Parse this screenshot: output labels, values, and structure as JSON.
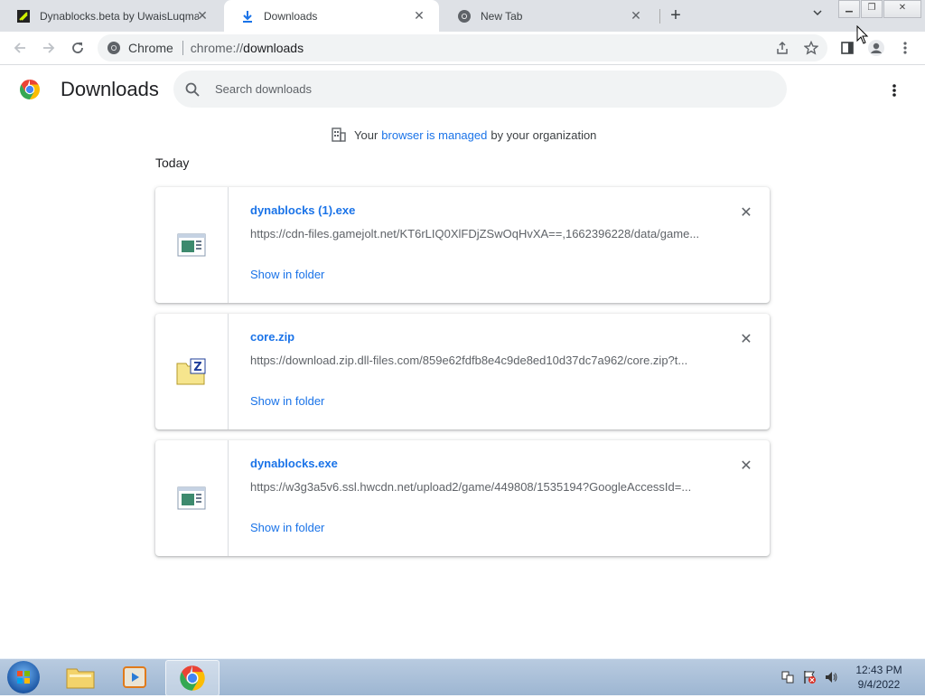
{
  "tabs": [
    {
      "label": "Dynablocks.beta by UwaisLuqman",
      "icon": "gamejolt-icon",
      "active": false
    },
    {
      "label": "Downloads",
      "icon": "download-icon",
      "active": true
    },
    {
      "label": "New Tab",
      "icon": "chrome-icon",
      "active": false
    }
  ],
  "omnibox": {
    "chip": "Chrome",
    "url_scheme": "chrome://",
    "url_host": "downloads"
  },
  "page": {
    "title": "Downloads",
    "search_placeholder": "Search downloads",
    "managed": {
      "prefix": "Your",
      "link": "browser is managed",
      "suffix": "by your organization"
    },
    "section_date": "Today"
  },
  "downloads": [
    {
      "name": "dynablocks (1).exe",
      "url": "https://cdn-files.gamejolt.net/KT6rLIQ0XlFDjZSwOqHvXA==,1662396228/data/game...",
      "action": "Show in folder",
      "icon": "exe-file-icon"
    },
    {
      "name": "core.zip",
      "url": "https://download.zip.dll-files.com/859e62fdfb8e4c9de8ed10d37dc7a962/core.zip?t...",
      "action": "Show in folder",
      "icon": "zip-file-icon"
    },
    {
      "name": "dynablocks.exe",
      "url": "https://w3g3a5v6.ssl.hwcdn.net/upload2/game/449808/1535194?GoogleAccessId=...",
      "action": "Show in folder",
      "icon": "exe-file-icon"
    }
  ],
  "taskbar": {
    "time": "12:43 PM",
    "date": "9/4/2022"
  },
  "colors": {
    "link": "#1a73e8",
    "tabstrip": "#dee1e6",
    "taskbar": "#a9c0da"
  }
}
